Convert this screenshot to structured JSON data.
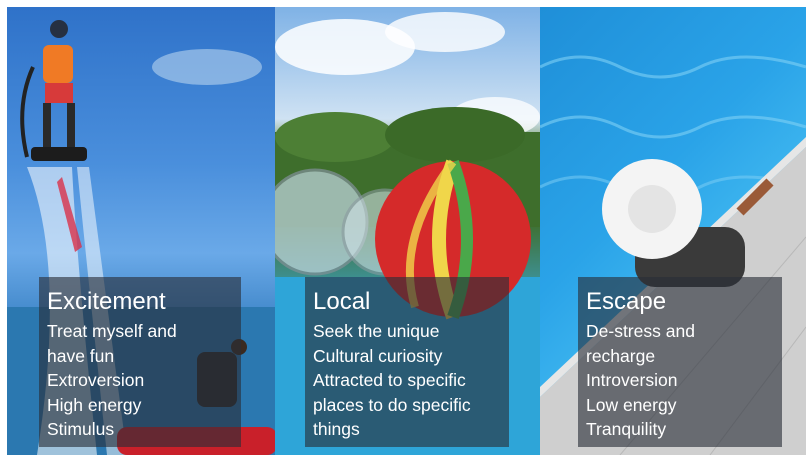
{
  "panels": [
    {
      "title": "Excitement",
      "lines": [
        "Treat myself and",
        "have fun",
        "Extroversion",
        "High energy",
        "Stimulus"
      ]
    },
    {
      "title": "Local",
      "lines": [
        "Seek the unique",
        "Cultural curiosity",
        "Attracted to specific",
        "places to do specific",
        "things"
      ]
    },
    {
      "title": "Escape",
      "lines": [
        "De-stress and",
        "recharge",
        "Introversion",
        "Low energy",
        "Tranquility"
      ]
    }
  ],
  "colors": {
    "caption_bg": "#2d3340",
    "caption_text": "#ffffff"
  }
}
